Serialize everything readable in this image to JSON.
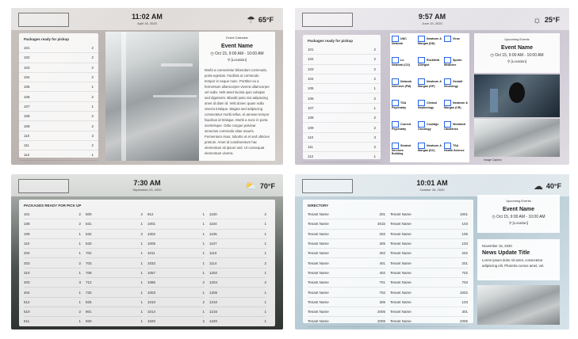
{
  "screen1": {
    "time": "11:02 AM",
    "date": "April 16, 2020",
    "temp": "65°F",
    "weather_icon": "cloud-rain",
    "packages_title": "Packages ready for pickup",
    "rows": [
      [
        "101",
        "2"
      ],
      [
        "102",
        "2"
      ],
      [
        "103",
        "2"
      ],
      [
        "104",
        "2"
      ],
      [
        "105",
        "1"
      ],
      [
        "106",
        "2"
      ],
      [
        "107",
        "1"
      ],
      [
        "108",
        "2"
      ],
      [
        "109",
        "2"
      ],
      [
        "110",
        "3"
      ],
      [
        "111",
        "2"
      ],
      [
        "112",
        "1"
      ]
    ],
    "event_label": "Event Calendar",
    "event_name": "Event Name",
    "event_when": "Oct 15, 9:00 AM - 10:00 AM",
    "event_where": "[Location]",
    "lorem": "Morbi a consectetur bibendum commodo, porta egestas. Facilisis ut commodo tempor in neque nunc. Porttitor eu a fermentum ullamcorper viverra ullamcorper vel nulla. Velit amet lacinia quis volutpat sed dignissim. Blandit justo nisi adipiscing amet id diam id. Velit donec quam nulla viverra tristique. Magna sed adipiscing consectetur morbi tellus, et aenean tempor faucibus id tristique. Morbi a nunc in porta scelerisque. Odio congue pulvinar senectus commodo vitae mauris. Fermentum risus, lobortis ut et sed ultricies pretium. Amet id condimentum hac elementum sit ipsum sed. Ut consequat elementum viverra."
  },
  "screen2": {
    "time": "9:57 AM",
    "date": "June 15, 2020",
    "temp": "25°F",
    "weather_icon": "sun-cloud",
    "packages_title": "Packages ready for pickup",
    "rows": [
      [
        "101",
        "2"
      ],
      [
        "102",
        "2"
      ],
      [
        "103",
        "2"
      ],
      [
        "104",
        "2"
      ],
      [
        "105",
        "1"
      ],
      [
        "106",
        "2"
      ],
      [
        "107",
        "1"
      ],
      [
        "108",
        "2"
      ],
      [
        "109",
        "2"
      ],
      [
        "110",
        "3"
      ],
      [
        "111",
        "2"
      ],
      [
        "112",
        "1"
      ]
    ],
    "directory": [
      "UNC Network",
      "Newborn & Morgan (DD)",
      "Virus",
      "Lo Network (CO)",
      "Rockfield Allergist",
      "Sports Medicine",
      "Network Intensive (FM)",
      "Newborn & Morgan (GP)",
      "Gestalt Neurology",
      "TSA Psychiatry",
      "Clinical Nephrology",
      "Newborn & Morgan (CR)",
      "Current Psychiatry",
      "Coolidge Oncology",
      "Westland Obstetrics",
      "Student Services Building",
      "Newborn & Morgan (DC)",
      "TSA Health Science"
    ],
    "event_label": "Upcoming Events",
    "event_name": "Event Name",
    "event_when": "Oct 15, 9:00 AM - 10:00 AM",
    "event_where": "[Location]",
    "caption": "Image Caption"
  },
  "screen3": {
    "time": "7:30 AM",
    "date": "September 23, 2020",
    "temp": "70°F",
    "weather_icon": "cloud-sun",
    "packages_title": "PACKAGES READY FOR PICK UP",
    "columns": [
      [
        [
          "101",
          "2"
        ],
        [
          "108",
          "2"
        ],
        [
          "109",
          "1"
        ],
        [
          "110",
          "1"
        ],
        [
          "204",
          "1"
        ],
        [
          "203",
          "2"
        ],
        [
          "310",
          "1"
        ],
        [
          "403",
          "3"
        ],
        [
          "404",
          "1"
        ],
        [
          "512",
          "1"
        ],
        [
          "510",
          "2"
        ],
        [
          "511",
          "1"
        ]
      ],
      [
        [
          "600",
          "2"
        ],
        [
          "631",
          "1"
        ],
        [
          "632",
          "2"
        ],
        [
          "633",
          "1"
        ],
        [
          "702",
          "1"
        ],
        [
          "703",
          "1"
        ],
        [
          "709",
          "1"
        ],
        [
          "712",
          "1"
        ],
        [
          "720",
          "1"
        ],
        [
          "825",
          "1"
        ],
        [
          "901",
          "1"
        ],
        [
          "920",
          "1"
        ]
      ],
      [
        [
          "912",
          "1"
        ],
        [
          "1001",
          "1"
        ],
        [
          "1002",
          "1"
        ],
        [
          "1005",
          "1"
        ],
        [
          "1011",
          "1"
        ],
        [
          "1032",
          "1"
        ],
        [
          "1057",
          "1"
        ],
        [
          "1086",
          "2"
        ],
        [
          "1003",
          "1"
        ],
        [
          "1010",
          "2"
        ],
        [
          "1014",
          "1"
        ],
        [
          "1020",
          "2"
        ]
      ],
      [
        [
          "1100",
          "2"
        ],
        [
          "1104",
          "1"
        ],
        [
          "1105",
          "1"
        ],
        [
          "1107",
          "1"
        ],
        [
          "1110",
          "1"
        ],
        [
          "1114",
          "2"
        ],
        [
          "1202",
          "1"
        ],
        [
          "1204",
          "2"
        ],
        [
          "1205",
          "1"
        ],
        [
          "1210",
          "1"
        ],
        [
          "1215",
          "1"
        ],
        [
          "1220",
          "1"
        ]
      ]
    ]
  },
  "screen4": {
    "time": "10:01 AM",
    "date": "October 26, 2020",
    "temp": "40°F",
    "weather_icon": "cloud",
    "directory_title": "DIRECTORY",
    "tenant_label": "Tenant Name",
    "left_units": [
      "201",
      "301b",
      "202",
      "305",
      "302",
      "401",
      "402",
      "701",
      "702",
      "305",
      "2005",
      "2005"
    ],
    "right_units": [
      "1001",
      "103",
      "105",
      "103",
      "202",
      "201",
      "702",
      "703",
      "1002",
      "103",
      "301",
      "2005"
    ],
    "event_label": "Upcoming Events",
    "event_name": "Event Name",
    "event_when": "Oct 15, 9:00 AM - 10:00 AM",
    "event_where": "[Location]",
    "news_date": "November 16, 2020",
    "news_title": "News Update Title",
    "news_body": "Lorem ipsum dolor sit amet, consectetur adipiscing elit. Pharetra cursus amet, vel."
  }
}
